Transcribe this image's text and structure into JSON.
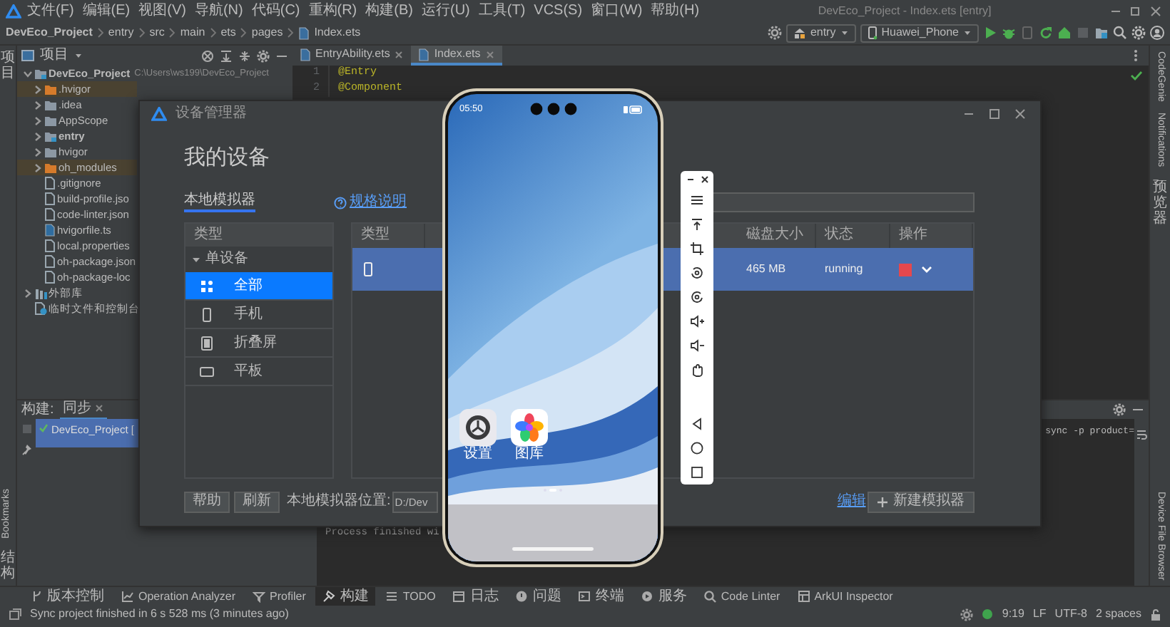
{
  "window": {
    "title": "DevEco_Project - Index.ets [entry]"
  },
  "menu": [
    "文件(F)",
    "编辑(E)",
    "视图(V)",
    "导航(N)",
    "代码(C)",
    "重构(R)",
    "构建(B)",
    "运行(U)",
    "工具(T)",
    "VCS(S)",
    "窗口(W)",
    "帮助(H)"
  ],
  "breadcrumbs": [
    {
      "label": "DevEco_Project",
      "kind": "project"
    },
    {
      "label": "entry",
      "kind": "folder"
    },
    {
      "label": "src",
      "kind": "folder"
    },
    {
      "label": "main",
      "kind": "folder"
    },
    {
      "label": "ets",
      "kind": "folder"
    },
    {
      "label": "pages",
      "kind": "folder"
    },
    {
      "label": "Index.ets",
      "kind": "file"
    }
  ],
  "toolbar": {
    "run_config": "entry",
    "device": "Huawei_Phone"
  },
  "left_strip": {
    "top": [
      {
        "label": "项目",
        "kind": "stacked"
      }
    ],
    "bottom": [
      {
        "label": "Bookmarks",
        "kind": "rotated"
      },
      {
        "label": "结构",
        "kind": "stacked"
      }
    ]
  },
  "right_strip": {
    "top": [
      {
        "label": "CodeGenie",
        "kind": "rotated"
      },
      {
        "label": "Notifications",
        "kind": "rotated"
      },
      {
        "label": "预览器",
        "kind": "stacked"
      }
    ],
    "bottom": [
      {
        "label": "Device File Browser",
        "kind": "rotated"
      }
    ]
  },
  "project_panel": {
    "title": "项目",
    "tree": [
      {
        "label": "DevEco_Project",
        "path": "C:\\Users\\ws199\\DevEco_Project",
        "kind": "module",
        "expanded": true,
        "children": [
          {
            "label": ".hvigor",
            "kind": "folder",
            "expanded": false,
            "excluded": true
          },
          {
            "label": ".idea",
            "kind": "folder",
            "expanded": false,
            "excluded": false
          },
          {
            "label": "AppScope",
            "kind": "folder",
            "expanded": false,
            "excluded": false
          },
          {
            "label": "entry",
            "kind": "module",
            "expanded": false,
            "excluded": false
          },
          {
            "label": "hvigor",
            "kind": "folder",
            "expanded": false,
            "excluded": false
          },
          {
            "label": "oh_modules",
            "kind": "folder",
            "expanded": false,
            "excluded": true
          },
          {
            "label": ".gitignore",
            "kind": "file",
            "excluded": false
          },
          {
            "label": "build-profile.jso",
            "kind": "file",
            "excluded": false
          },
          {
            "label": "code-linter.json",
            "kind": "file",
            "excluded": false
          },
          {
            "label": "hvigorfile.ts",
            "kind": "script",
            "excluded": false
          },
          {
            "label": "local.properties",
            "kind": "file",
            "excluded": false
          },
          {
            "label": "oh-package.json",
            "kind": "file",
            "excluded": false
          },
          {
            "label": "oh-package-loc",
            "kind": "file",
            "excluded": false
          }
        ]
      },
      {
        "label": "外部库",
        "kind": "library",
        "expanded": false
      },
      {
        "label": "临时文件和控制台",
        "kind": "scratch"
      }
    ]
  },
  "editor": {
    "tabs": [
      {
        "label": "EntryAbility.ets",
        "selected": false
      },
      {
        "label": "Index.ets",
        "selected": true
      }
    ],
    "lines": [
      {
        "number": "1",
        "code": "@Entry"
      },
      {
        "number": "2",
        "code": "@Component"
      }
    ]
  },
  "build_panel": {
    "title": "构建:",
    "tabs": [
      {
        "label": "同步",
        "selected": true
      }
    ],
    "items": [
      {
        "label": "DevEco_Project [",
        "selected": true
      }
    ],
    "console": {
      "tail": "sync -p product=",
      "lines": [
        "Process finished wi"
      ]
    }
  },
  "device_manager": {
    "title": "设备管理器",
    "heading": "我的设备",
    "tabs": [
      {
        "label": "本地模拟器",
        "selected": true
      }
    ],
    "spec_link": "规格说明",
    "categories": {
      "header": "类型",
      "group": {
        "label": "单设备",
        "expanded": true,
        "items": [
          {
            "label": "全部",
            "kind": "grid",
            "selected": true
          },
          {
            "label": "手机",
            "kind": "phone",
            "selected": false
          },
          {
            "label": "折叠屏",
            "kind": "foldable",
            "selected": false
          },
          {
            "label": "平板",
            "kind": "tablet",
            "selected": false
          }
        ]
      }
    },
    "table": {
      "columns": [
        "类型",
        "磁盘大小",
        "状态",
        "操作"
      ],
      "rows": [
        {
          "kind": "phone",
          "disk": "465 MB",
          "status": "running",
          "selected": true
        }
      ]
    },
    "buttons": [
      "帮助",
      "刷新"
    ],
    "location_label": "本地模拟器位置:",
    "location_value": "D:/Dev",
    "edit_link": "编辑",
    "new_button": "新建模拟器"
  },
  "emulator": {
    "time": "05:50",
    "apps": [
      {
        "label": "设置",
        "kind": "settings"
      },
      {
        "label": "图库",
        "kind": "gallery"
      }
    ]
  },
  "tool_windows": [
    {
      "label": "版本控制",
      "kind": "vcs",
      "selected": false
    },
    {
      "label": "Operation Analyzer",
      "kind": "analyzer",
      "selected": false
    },
    {
      "label": "Profiler",
      "kind": "profiler",
      "selected": false
    },
    {
      "label": "构建",
      "kind": "build",
      "selected": true
    },
    {
      "label": "TODO",
      "kind": "todo",
      "selected": false
    },
    {
      "label": "日志",
      "kind": "log",
      "selected": false
    },
    {
      "label": "问题",
      "kind": "problems",
      "selected": false
    },
    {
      "label": "终端",
      "kind": "terminal",
      "selected": false
    },
    {
      "label": "服务",
      "kind": "services",
      "selected": false
    },
    {
      "label": "Code Linter",
      "kind": "linter",
      "selected": false
    },
    {
      "label": "ArkUI Inspector",
      "kind": "inspector",
      "selected": false
    }
  ],
  "status_bar": {
    "message": "Sync project finished in 6 s 528 ms (3 minutes ago)",
    "items": [
      "9:19",
      "LF",
      "UTF-8",
      "2 spaces"
    ]
  }
}
